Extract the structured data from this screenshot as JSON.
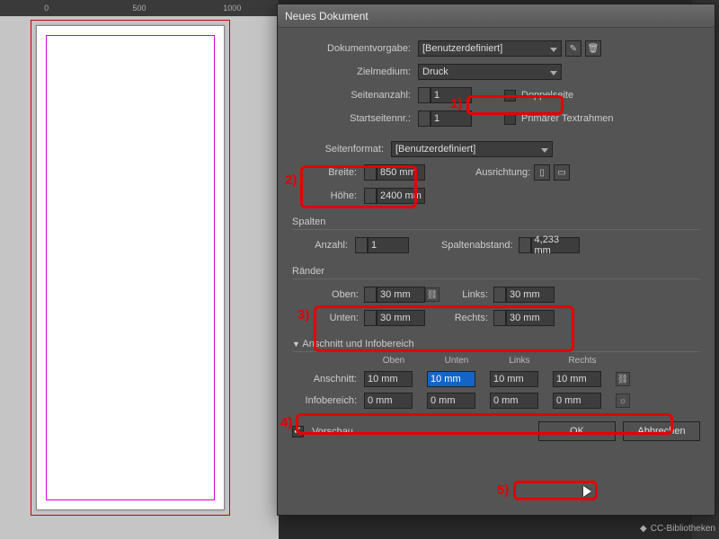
{
  "ruler": [
    "0",
    "500",
    "1000"
  ],
  "dialog": {
    "title": "Neues Dokument",
    "preset_label": "Dokumentvorgabe:",
    "preset_value": "[Benutzerdefiniert]",
    "intent_label": "Zielmedium:",
    "intent_value": "Druck",
    "pages_label": "Seitenanzahl:",
    "pages_value": "1",
    "facing_label": "Doppelseite",
    "startpage_label": "Startseitennr.:",
    "startpage_value": "1",
    "primary_frame_label": "Primärer Textrahmen",
    "pagesize_label": "Seitenformat:",
    "pagesize_value": "[Benutzerdefiniert]",
    "width_label": "Breite:",
    "width_value": "850 mm",
    "height_label": "Höhe:",
    "height_value": "2400 mm",
    "orientation_label": "Ausrichtung:",
    "columns_title": "Spalten",
    "columns_count_label": "Anzahl:",
    "columns_count_value": "1",
    "gutter_label": "Spaltenabstand:",
    "gutter_value": "4,233 mm",
    "margins_title": "Ränder",
    "margin_top_label": "Oben:",
    "margin_bottom_label": "Unten:",
    "margin_left_label": "Links:",
    "margin_right_label": "Rechts:",
    "margin_value": "30 mm",
    "bleed_title": "Anschnitt und Infobereich",
    "col_top": "Oben",
    "col_bottom": "Unten",
    "col_left": "Links",
    "col_right": "Rechts",
    "bleed_label": "Anschnitt:",
    "bleed_value": "10 mm",
    "slug_label": "Infobereich:",
    "slug_value": "0 mm",
    "preview_label": "Vorschau",
    "ok": "OK",
    "cancel": "Abbrechen"
  },
  "annotations": {
    "n1": "1)",
    "n2": "2)",
    "n3": "3)",
    "n4": "4)",
    "n5": "5)"
  },
  "panels": {
    "cc": "CC-Bibliotheken",
    "thek": "thek",
    "iblioth": "iblioth"
  }
}
